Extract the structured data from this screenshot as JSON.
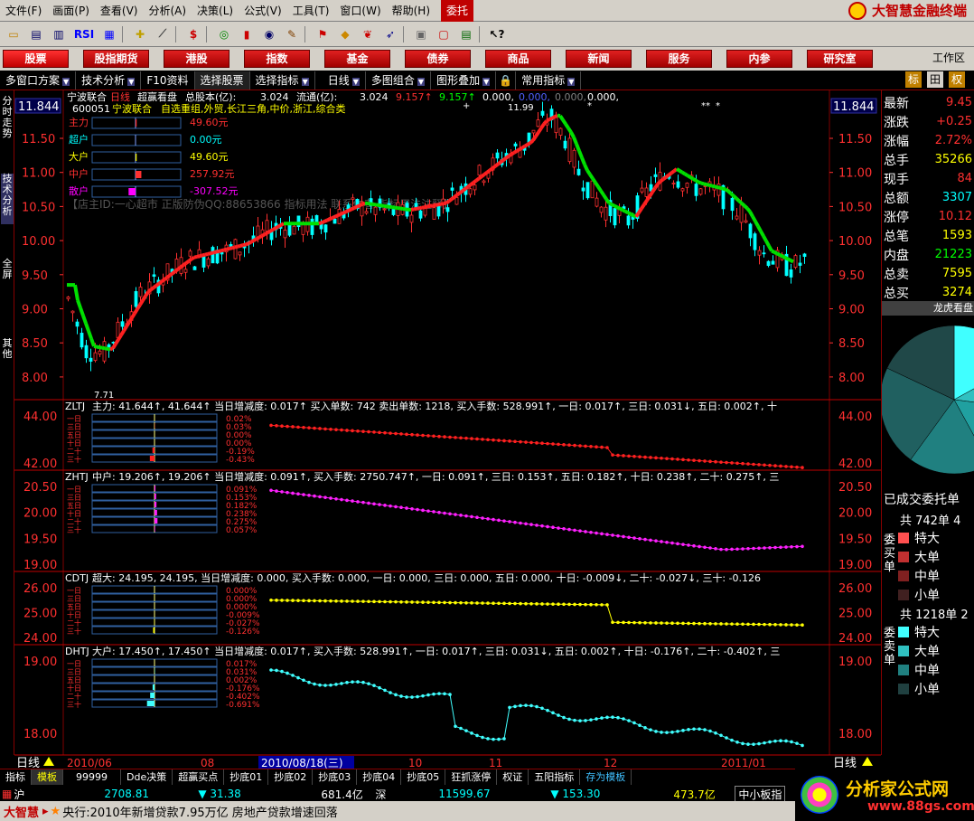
{
  "menu": {
    "items": [
      "文件(F)",
      "画面(P)",
      "查看(V)",
      "分析(A)",
      "决策(L)",
      "公式(V)",
      "工具(T)",
      "窗口(W)",
      "帮助(H)"
    ],
    "entrust": "委托",
    "brand": "大智慧金融终端"
  },
  "toolbar": {
    "rsi_label": "RSI"
  },
  "nav": {
    "buttons": [
      "股票",
      "股指期货",
      "港股",
      "指数",
      "基金",
      "债券",
      "商品",
      "新闻",
      "服务",
      "内参",
      "研究室"
    ],
    "workarea": "工作区"
  },
  "subbar": {
    "items": [
      "多窗口方案",
      "技术分析",
      "F10资料",
      "选择股票",
      "选择指标",
      "日线",
      "多图组合",
      "图形叠加",
      "常用指标"
    ],
    "right_buttons": [
      "标",
      "田",
      "权"
    ]
  },
  "vtabs": [
    "分时走势",
    "技术分析",
    "全屏",
    "其他"
  ],
  "stock": {
    "name": "宁波联合",
    "period": "日线",
    "indicator": "超赢看盘",
    "total_shares_label": "总股本(亿):",
    "total_shares": "3.024",
    "float_label": "流通(亿):",
    "float_shares": "3.024",
    "vals": [
      "9.157↑",
      "9.157↑",
      "0.000,",
      "0.000,",
      "0.000,",
      "0.000,"
    ],
    "code": "600051",
    "code_name": "宁波联合",
    "sectors": "自选重组,外贸,长江三角,中价,浙江,综合类",
    "watermark": "【店主ID:一心超市 正版防伪QQ:88653866  指标用法  联系作者  指标用法注释】"
  },
  "flows": [
    {
      "label": "主力",
      "value": "49.60元",
      "color": "#ff3030"
    },
    {
      "label": "超户",
      "value": "0.00元",
      "color": "#00ffff"
    },
    {
      "label": "大户",
      "value": "49.60元",
      "color": "#ffff00"
    },
    {
      "label": "中户",
      "value": "257.92元",
      "color": "#ff3030"
    },
    {
      "label": "散户",
      "value": "-307.52元",
      "color": "#ff00ff"
    }
  ],
  "price_axis": [
    "11.50",
    "11.00",
    "10.50",
    "10.00",
    "9.50",
    "9.00",
    "8.50",
    "8.00"
  ],
  "price_top": "11.844",
  "high_mark": "11.99",
  "low_mark": "7.71",
  "panels": [
    {
      "id": "ZLTJ",
      "head": "主力: 41.644↑, 41.644↑ 当日增减度: 0.017↑ 买入单数: 742 卖出单数: 1218, 买入手数: 528.991↑, 一日: 0.017↑, 三日: 0.031↓, 五日: 0.002↑, 十",
      "axis": [
        "44.00",
        "42.00"
      ],
      "rows": [
        "0.02%",
        "0.03%",
        "0.00%",
        "0.00%",
        "-0.19%",
        "-0.43%"
      ],
      "color": "#ff2020"
    },
    {
      "id": "ZHTJ",
      "head": "中户: 19.206↑, 19.206↑ 当日增减度: 0.091↑, 买入手数: 2750.747↑, 一日: 0.091↑, 三日: 0.153↑, 五日: 0.182↑, 十日: 0.238↑, 二十: 0.275↑, 三",
      "axis": [
        "20.50",
        "20.00",
        "19.50",
        "19.00"
      ],
      "rows": [
        "0.091%",
        "0.153%",
        "0.182%",
        "0.238%",
        "0.275%",
        "0.057%"
      ],
      "color": "#ff20ff"
    },
    {
      "id": "CDTJ",
      "head": "超大: 24.195, 24.195, 当日增减度: 0.000, 买入手数: 0.000, 一日: 0.000, 三日: 0.000, 五日: 0.000, 十日: -0.009↓, 二十: -0.027↓, 三十: -0.126",
      "axis": [
        "26.00",
        "25.00",
        "24.00"
      ],
      "rows": [
        "0.000%",
        "0.000%",
        "0.000%",
        "-0.009%",
        "-0.027%",
        "-0.126%"
      ],
      "color": "#ffff00"
    },
    {
      "id": "DHTJ",
      "head": "大户: 17.450↑, 17.450↑ 当日增减度: 0.017↑, 买入手数: 528.991↑, 一日: 0.017↑, 三日: 0.031↓, 五日: 0.002↑, 十日: -0.176↑, 二十: -0.402↑, 三",
      "axis": [
        "19.00",
        "18.00"
      ],
      "rows": [
        "0.017%",
        "0.031%",
        "0.002%",
        "-0.176%",
        "-0.402%",
        "-0.691%"
      ],
      "color": "#40ffff"
    }
  ],
  "rowlabels": [
    "一日",
    "三日",
    "五日",
    "十日",
    "二十",
    "三十"
  ],
  "xaxis": {
    "left": "日线",
    "labels": [
      "2010/06",
      "08",
      "10",
      "11",
      "12",
      "2011/01"
    ],
    "cursor": "2010/08/18(三)",
    "right": "日线"
  },
  "quote": [
    {
      "k": "最新",
      "v": "9.45",
      "c": "#ff3030"
    },
    {
      "k": "涨跌",
      "v": "+0.25",
      "c": "#ff3030"
    },
    {
      "k": "涨幅",
      "v": "2.72%",
      "c": "#ff3030"
    },
    {
      "k": "总手",
      "v": "35266",
      "c": "#ffff00"
    },
    {
      "k": "现手",
      "v": "84",
      "c": "#ff3030"
    },
    {
      "k": "总额",
      "v": "3307",
      "c": "#00ffff"
    },
    {
      "k": "涨停",
      "v": "10.12",
      "c": "#ff3030"
    },
    {
      "k": "总笔",
      "v": "1593",
      "c": "#ffff00"
    },
    {
      "k": "内盘",
      "v": "21223",
      "c": "#00ff00"
    },
    {
      "k": "总卖",
      "v": "7595",
      "c": "#ffff00"
    },
    {
      "k": "总买",
      "v": "3274",
      "c": "#ffff00"
    }
  ],
  "dragon": {
    "title": "龙虎看盘",
    "done": "已成交委托单",
    "sell_total": "共 742单 4",
    "buy_total": "共 1218单 2",
    "sell_side": "委买单",
    "buy_side": "委卖单",
    "cats": [
      "特大",
      "大单",
      "中单",
      "小单"
    ],
    "sell_colors": [
      "#ff5050",
      "#c03030",
      "#802020",
      "#402020"
    ],
    "buy_colors": [
      "#40ffff",
      "#30c0c0",
      "#208080",
      "#204040"
    ],
    "pie": [
      {
        "value": 17,
        "color": "#40ffff"
      },
      {
        "value": 10,
        "color": "#30c0c0"
      },
      {
        "value": 15,
        "color": "#20a0a0"
      },
      {
        "value": 18,
        "color": "#208080"
      },
      {
        "value": 22,
        "color": "#206060"
      },
      {
        "value": 18,
        "color": "#204848"
      }
    ]
  },
  "btabs": [
    "指标",
    "模板",
    "99999",
    "Dde决策",
    "超赢买点",
    "抄底01",
    "抄底02",
    "抄底03",
    "抄底04",
    "抄底05",
    "狂抓涨停",
    "权证",
    "五阳指标",
    "存为模板"
  ],
  "status": {
    "sh_label": "沪",
    "sh": "2708.81",
    "sh_chg": "▼ 31.38",
    "sh_amt": "681.4亿",
    "sz_label": "深",
    "sz": "11599.67",
    "sz_chg": "▼ 153.30",
    "sz_amt": "473.7亿",
    "tag": "中小板指"
  },
  "news": {
    "brand": "大智慧",
    "text": "央行:2010年新增贷款7.95万亿 房地产贷款增速回落"
  },
  "ad": {
    "title": "分析家公式网",
    "url": "www.88gs.com"
  },
  "colors": {
    "up": "#ff3030",
    "down": "#00ffff",
    "grid": "#800000",
    "axis": "#ff3030"
  }
}
